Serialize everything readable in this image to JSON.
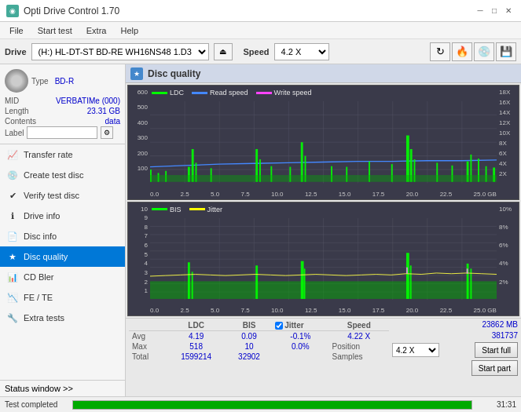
{
  "app": {
    "title": "Opti Drive Control 1.70",
    "icon": "●"
  },
  "titlebar": {
    "minimize": "─",
    "maximize": "□",
    "close": "✕"
  },
  "menubar": {
    "items": [
      "File",
      "Start test",
      "Extra",
      "Help"
    ]
  },
  "drivebar": {
    "drive_label": "Drive",
    "drive_value": "(H:) HL-DT-ST BD-RE  WH16NS48 1.D3",
    "speed_label": "Speed",
    "speed_value": "4.2 X"
  },
  "sidebar": {
    "disc": {
      "type_label": "Type",
      "type_value": "BD-R",
      "mid_label": "MID",
      "mid_value": "VERBATIMe (000)",
      "length_label": "Length",
      "length_value": "23.31 GB",
      "contents_label": "Contents",
      "contents_value": "data",
      "label_label": "Label",
      "label_placeholder": ""
    },
    "nav": [
      {
        "id": "transfer-rate",
        "label": "Transfer rate",
        "icon": "📈"
      },
      {
        "id": "create-test-disc",
        "label": "Create test disc",
        "icon": "💿"
      },
      {
        "id": "verify-test-disc",
        "label": "Verify test disc",
        "icon": "✔"
      },
      {
        "id": "drive-info",
        "label": "Drive info",
        "icon": "ℹ"
      },
      {
        "id": "disc-info",
        "label": "Disc info",
        "icon": "📄"
      },
      {
        "id": "disc-quality",
        "label": "Disc quality",
        "icon": "★",
        "active": true
      },
      {
        "id": "cd-bler",
        "label": "CD Bler",
        "icon": "📊"
      },
      {
        "id": "fe-te",
        "label": "FE / TE",
        "icon": "📉"
      },
      {
        "id": "extra-tests",
        "label": "Extra tests",
        "icon": "🔧"
      }
    ],
    "status_window": "Status window >>"
  },
  "disc_quality": {
    "title": "Disc quality",
    "chart1": {
      "legend": [
        {
          "label": "LDC",
          "color": "#00ff00"
        },
        {
          "label": "Read speed",
          "color": "#4488ff"
        },
        {
          "label": "Write speed",
          "color": "#ff44ff"
        }
      ],
      "y_labels_left": [
        "600",
        "500",
        "400",
        "300",
        "200",
        "100",
        ""
      ],
      "y_labels_right": [
        "18X",
        "16X",
        "14X",
        "12X",
        "10X",
        "8X",
        "6X",
        "4X",
        "2X",
        ""
      ],
      "x_labels": [
        "0.0",
        "2.5",
        "5.0",
        "7.5",
        "10.0",
        "12.5",
        "15.0",
        "17.5",
        "20.0",
        "22.5",
        "25.0 GB"
      ]
    },
    "chart2": {
      "legend": [
        {
          "label": "BIS",
          "color": "#00ff00"
        },
        {
          "label": "Jitter",
          "color": "#ffff00"
        }
      ],
      "y_labels_left": [
        "10",
        "9",
        "8",
        "7",
        "6",
        "5",
        "4",
        "3",
        "2",
        "1",
        ""
      ],
      "y_labels_right": [
        "10%",
        "8%",
        "6%",
        "4%",
        "2%",
        ""
      ],
      "x_labels": [
        "0.0",
        "2.5",
        "5.0",
        "7.5",
        "10.0",
        "12.5",
        "15.0",
        "17.5",
        "20.0",
        "22.5",
        "25.0 GB"
      ]
    },
    "stats": {
      "headers": [
        "LDC",
        "BIS",
        "",
        "Jitter",
        "Speed"
      ],
      "avg_label": "Avg",
      "avg_ldc": "4.19",
      "avg_bis": "0.09",
      "avg_jitter": "-0.1%",
      "avg_speed": "4.22 X",
      "max_label": "Max",
      "max_ldc": "518",
      "max_bis": "10",
      "max_jitter": "0.0%",
      "total_label": "Total",
      "total_ldc": "1599214",
      "total_bis": "32902",
      "position_label": "Position",
      "position_val": "23862 MB",
      "samples_label": "Samples",
      "samples_val": "381737",
      "speed_select": "4.2 X",
      "btn_start_full": "Start full",
      "btn_start_part": "Start part",
      "jitter_label": "✔ Jitter"
    }
  },
  "statusbar": {
    "status": "Test completed",
    "progress": 100,
    "time": "31:31"
  }
}
